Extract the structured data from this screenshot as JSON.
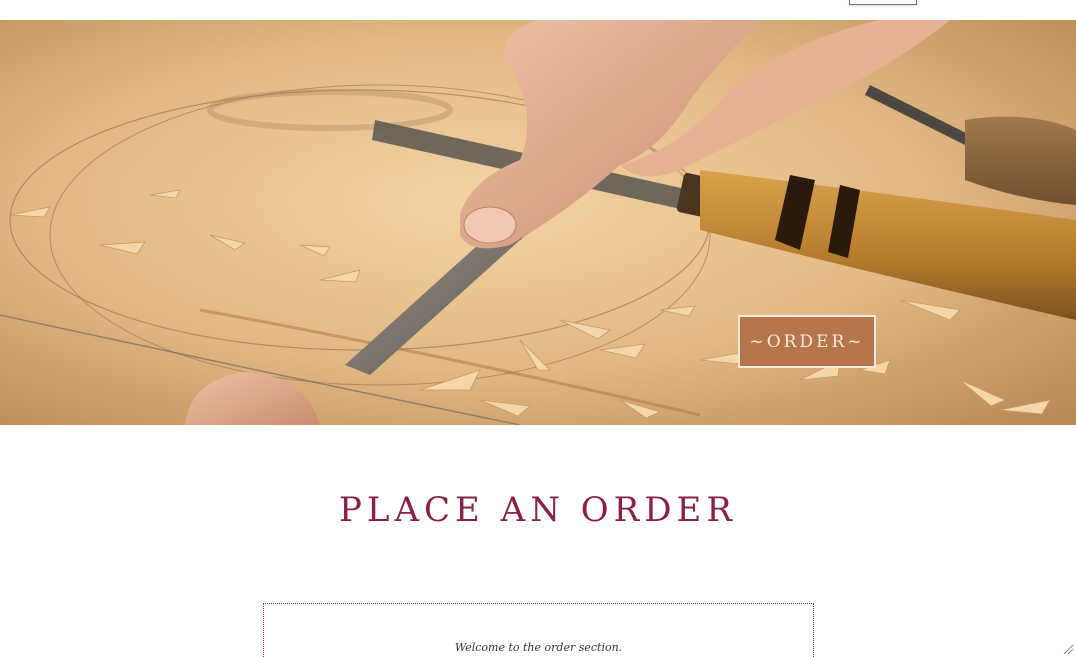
{
  "hero": {
    "image_icon": "woodcarving-chisel-hero-image",
    "order_button_label": "~ORDER~"
  },
  "section": {
    "title": "PLACE AN ORDER",
    "welcome_text": "Welcome to the order section."
  },
  "colors": {
    "accent": "#8a1f4b",
    "button_bg": "#b7754b",
    "wood": "#d9b27e"
  }
}
